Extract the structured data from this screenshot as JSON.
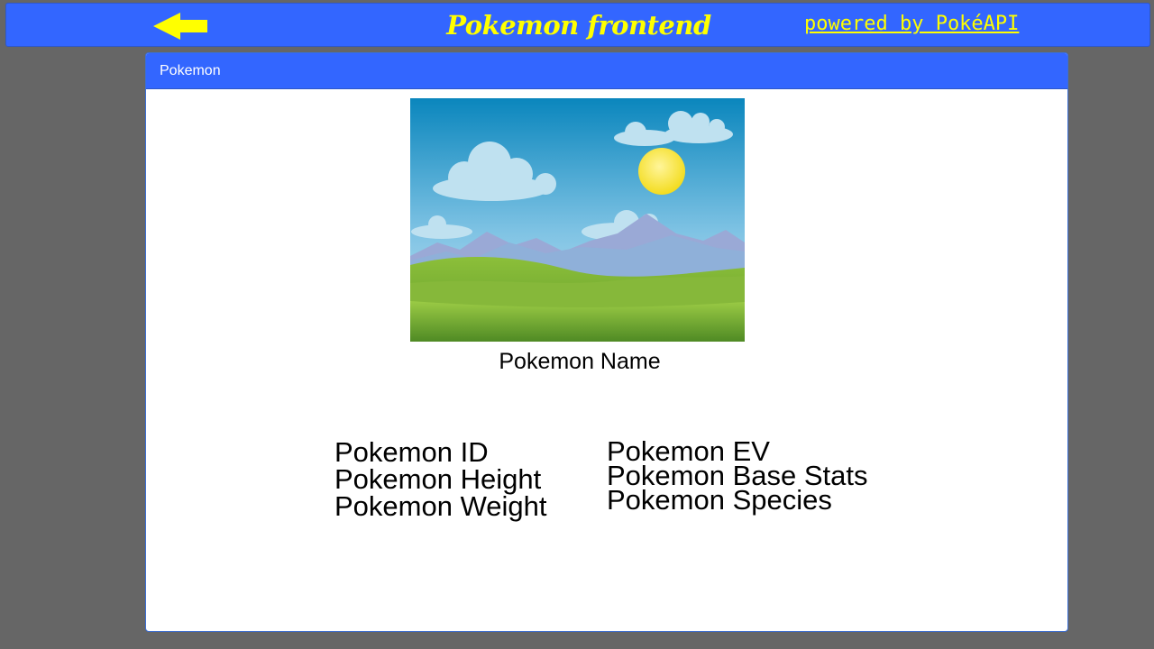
{
  "header": {
    "title": "Pokemon frontend",
    "powered_by": "powered by PokéAPI",
    "back_icon": "left-arrow-icon",
    "accent_color": "#3366ff",
    "title_color": "#ffff00"
  },
  "card": {
    "header_label": "Pokemon",
    "image_alt": "landscape placeholder",
    "name": "Pokemon Name",
    "left_fields": [
      "Pokemon ID",
      "Pokemon Height",
      "Pokemon Weight"
    ],
    "right_fields": [
      "Pokemon EV",
      "Pokemon Base Stats",
      "Pokemon Species"
    ]
  }
}
